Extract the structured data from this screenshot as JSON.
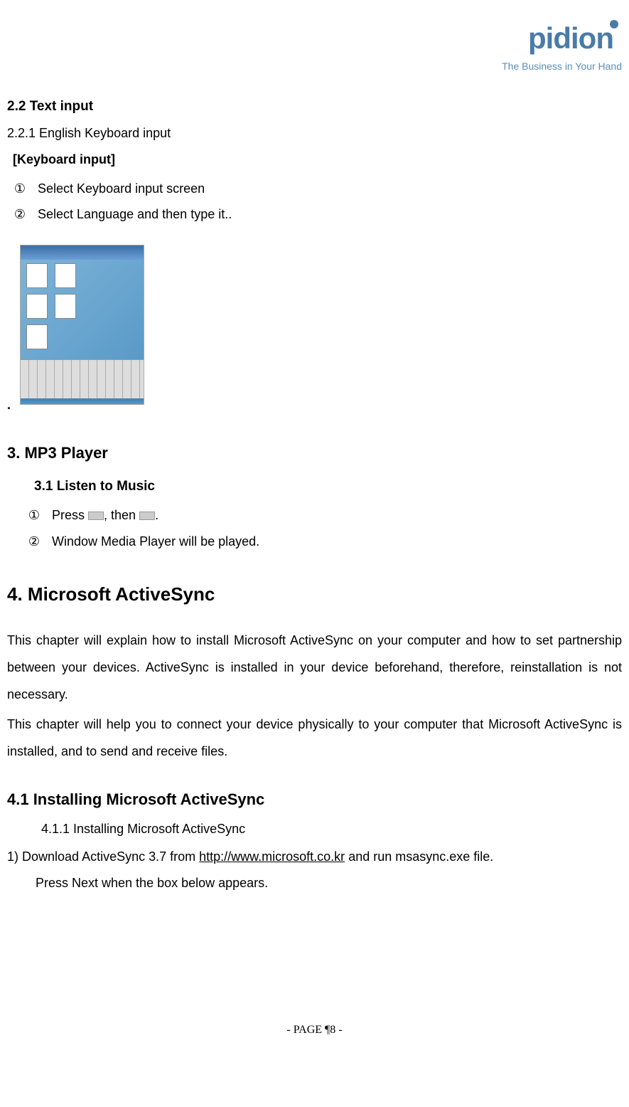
{
  "logo": {
    "brand": "pidion",
    "tagline": "The Business in Your Hand"
  },
  "section22": {
    "title": "2.2 Text input",
    "subtitle": "2.2.1 English Keyboard input",
    "label": "[Keyboard input]",
    "item1_num": "①",
    "item1_text": "Select Keyboard input screen",
    "item2_num": "②",
    "item2_text": "Select Language and then type it.."
  },
  "dot": ".",
  "section3": {
    "title": "3. MP3 Player",
    "subtitle": "3.1 Listen to Music",
    "item1_num": "①",
    "item1_prefix": "Press ",
    "item1_mid": ", then ",
    "item1_suffix": ".",
    "item2_num": "②",
    "item2_text": "Window Media Player will be played."
  },
  "section4": {
    "title": "4. Microsoft ActiveSync",
    "para1": "This chapter will explain how to install Microsoft ActiveSync on your computer and how to set partnership between your devices. ActiveSync is installed in your device beforehand, therefore, reinstallation is not necessary.",
    "para2": "This chapter will help you to connect your device physically to your computer that Microsoft ActiveSync is installed, and to send and receive files."
  },
  "section41": {
    "title": "4.1 Installing Microsoft ActiveSync",
    "subtitle": "4.1.1 Installing Microsoft ActiveSync",
    "step1_prefix": "1) Download ActiveSync 3.7 from ",
    "step1_link": "http://www.microsoft.co.kr",
    "step1_suffix": " and run msasync.exe file.",
    "step2": "Press Next when the box below appears."
  },
  "footer": "- PAGE ¶8 -"
}
